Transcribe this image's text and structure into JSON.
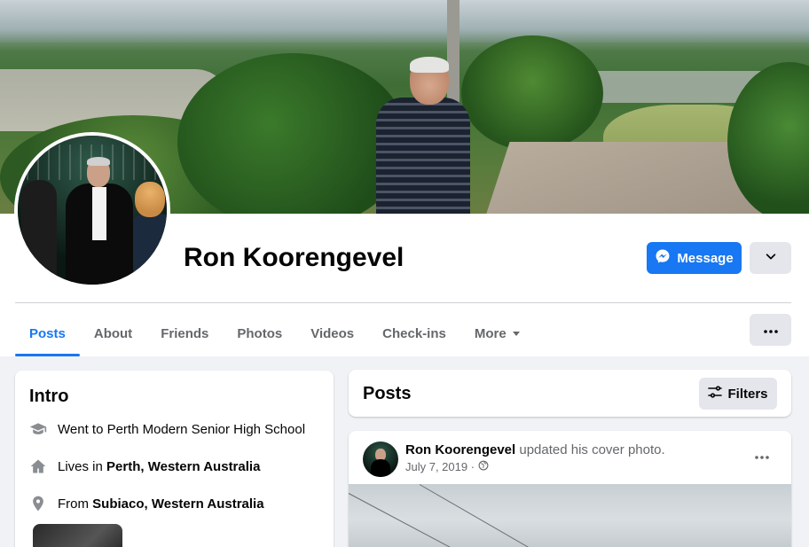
{
  "profile": {
    "name": "Ron Koorengevel",
    "message_button": "Message"
  },
  "tabs": [
    {
      "label": "Posts",
      "active": true
    },
    {
      "label": "About"
    },
    {
      "label": "Friends"
    },
    {
      "label": "Photos"
    },
    {
      "label": "Videos"
    },
    {
      "label": "Check-ins"
    },
    {
      "label": "More"
    }
  ],
  "intro": {
    "title": "Intro",
    "education": "Went to Perth Modern Senior High School",
    "lives_prefix": "Lives in ",
    "lives_place": "Perth, Western Australia",
    "from_prefix": "From ",
    "from_place": "Subiaco, Western Australia"
  },
  "posts": {
    "title": "Posts",
    "filters_label": "Filters",
    "items": [
      {
        "author": "Ron Koorengevel",
        "action": "updated his cover photo.",
        "date": "July 7, 2019 ·",
        "audience_icon": "globe-icon"
      }
    ]
  },
  "colors": {
    "accent": "#1877f2",
    "secondary_text": "#65676b",
    "button_gray": "#e4e6eb",
    "page_bg": "#f0f2f5"
  }
}
